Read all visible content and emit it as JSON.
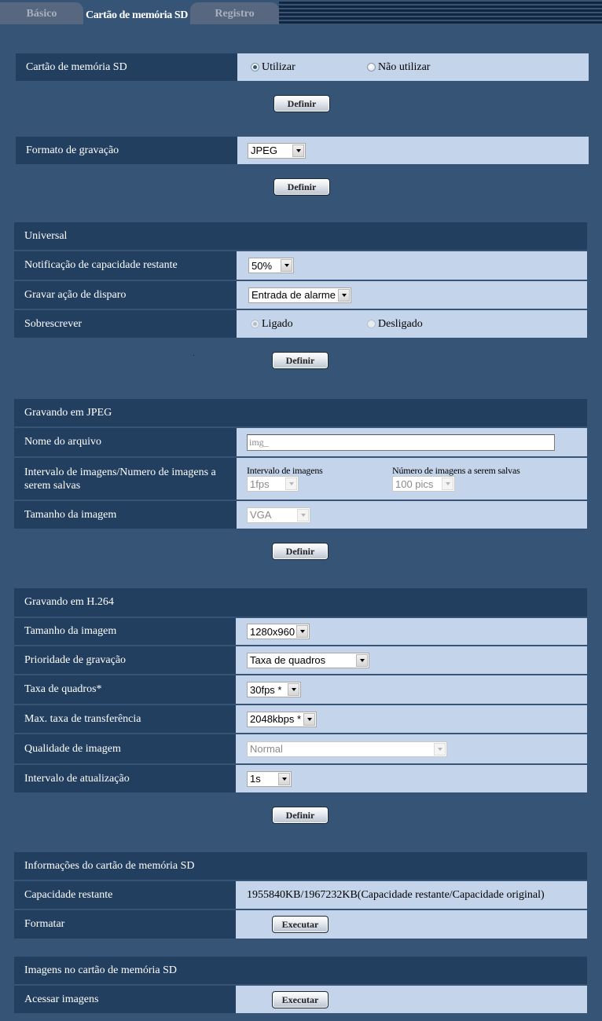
{
  "tabs": [
    {
      "label": "Básico",
      "active": false
    },
    {
      "label": "Cartão de memória SD",
      "active": true
    },
    {
      "label": "Registro",
      "active": false
    }
  ],
  "sd_card": {
    "label": "Cartão de memória SD",
    "options": [
      "Utilizar",
      "Não utilizar"
    ],
    "selected": "Utilizar",
    "set_button": "Definir"
  },
  "record_format": {
    "label": "Formato de gravação",
    "value": "JPEG",
    "set_button": "Definir"
  },
  "universal": {
    "title": "Universal",
    "remaining_capacity_notification": {
      "label": "Notificação de capacidade restante",
      "value": "50%"
    },
    "trigger_action": {
      "label": "Gravar ação de disparo",
      "value": "Entrada de alarme"
    },
    "overwrite": {
      "label": "Sobrescrever",
      "options": [
        "Ligado",
        "Desligado"
      ],
      "selected": "Ligado",
      "disabled": true
    },
    "set_button": "Definir"
  },
  "jpeg": {
    "title": "Gravando em JPEG",
    "file_name": {
      "label": "Nome do arquivo",
      "value": "img_"
    },
    "interval": {
      "label": "Intervalo de imagens/Numero de imagens a serem salvas",
      "interval_label": "Intervalo de imagens",
      "interval_value": "1fps",
      "count_label": "Número de imagens a serem salvas",
      "count_value": "100 pics"
    },
    "image_size": {
      "label": "Tamanho da imagem",
      "value": "VGA"
    },
    "set_button": "Definir"
  },
  "h264": {
    "title": "Gravando em H.264",
    "image_size": {
      "label": "Tamanho da imagem",
      "value": "1280x960"
    },
    "priority": {
      "label": "Prioridade de gravação",
      "value": "Taxa de quadros"
    },
    "frame_rate": {
      "label": "Taxa de quadros*",
      "value": "30fps *"
    },
    "max_bitrate": {
      "label": "Max. taxa de transferência",
      "value": "2048kbps *"
    },
    "quality": {
      "label": "Qualidade de imagem",
      "value": "Normal"
    },
    "refresh_interval": {
      "label": "Intervalo de atualização",
      "value": "1s"
    },
    "set_button": "Definir"
  },
  "sd_info": {
    "title": "Informações do cartão de memória SD",
    "remaining": {
      "label": "Capacidade restante",
      "value": "1955840KB/1967232KB(Capacidade restante/Capacidade original)"
    },
    "format": {
      "label": "Formatar",
      "button": "Executar"
    }
  },
  "sd_images": {
    "title": "Imagens no cartão de memória SD",
    "access": {
      "label": "Acessar imagens",
      "button": "Executar"
    }
  }
}
